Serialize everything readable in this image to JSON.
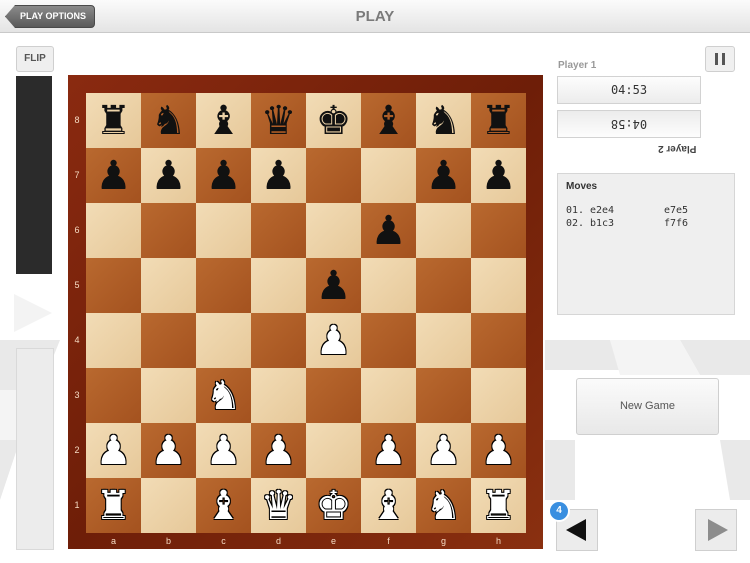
{
  "header": {
    "back_label": "PLAY OPTIONS",
    "title": "PLAY"
  },
  "controls": {
    "flip_label": "FLIP",
    "new_game_label": "New Game",
    "move_badge": "4"
  },
  "players": {
    "player1": {
      "name": "Player 1",
      "time": "04:53"
    },
    "player2": {
      "name": "Player 2",
      "time": "04:58"
    }
  },
  "moves": {
    "title": "Moves",
    "list": [
      {
        "num": "01.",
        "white": "e2e4",
        "black": "e7e5"
      },
      {
        "num": "02.",
        "white": "b1c3",
        "black": "f7f6"
      }
    ]
  },
  "board": {
    "files": [
      "a",
      "b",
      "c",
      "d",
      "e",
      "f",
      "g",
      "h"
    ],
    "ranks": [
      "8",
      "7",
      "6",
      "5",
      "4",
      "3",
      "2",
      "1"
    ],
    "position": [
      [
        "br",
        "bn",
        "bb",
        "bq",
        "bk",
        "bb",
        "bn",
        "br"
      ],
      [
        "bp",
        "bp",
        "bp",
        "bp",
        "",
        "",
        "bp",
        "bp"
      ],
      [
        "",
        "",
        "",
        "",
        "",
        "bp",
        "",
        ""
      ],
      [
        "",
        "",
        "",
        "",
        "bp",
        "",
        "",
        ""
      ],
      [
        "",
        "",
        "",
        "",
        "wp",
        "",
        "",
        ""
      ],
      [
        "",
        "",
        "wn",
        "",
        "",
        "",
        "",
        ""
      ],
      [
        "wp",
        "wp",
        "wp",
        "wp",
        "",
        "wp",
        "wp",
        "wp"
      ],
      [
        "wr",
        "",
        "wb",
        "wq",
        "wk",
        "wb",
        "wn",
        "wr"
      ]
    ]
  }
}
